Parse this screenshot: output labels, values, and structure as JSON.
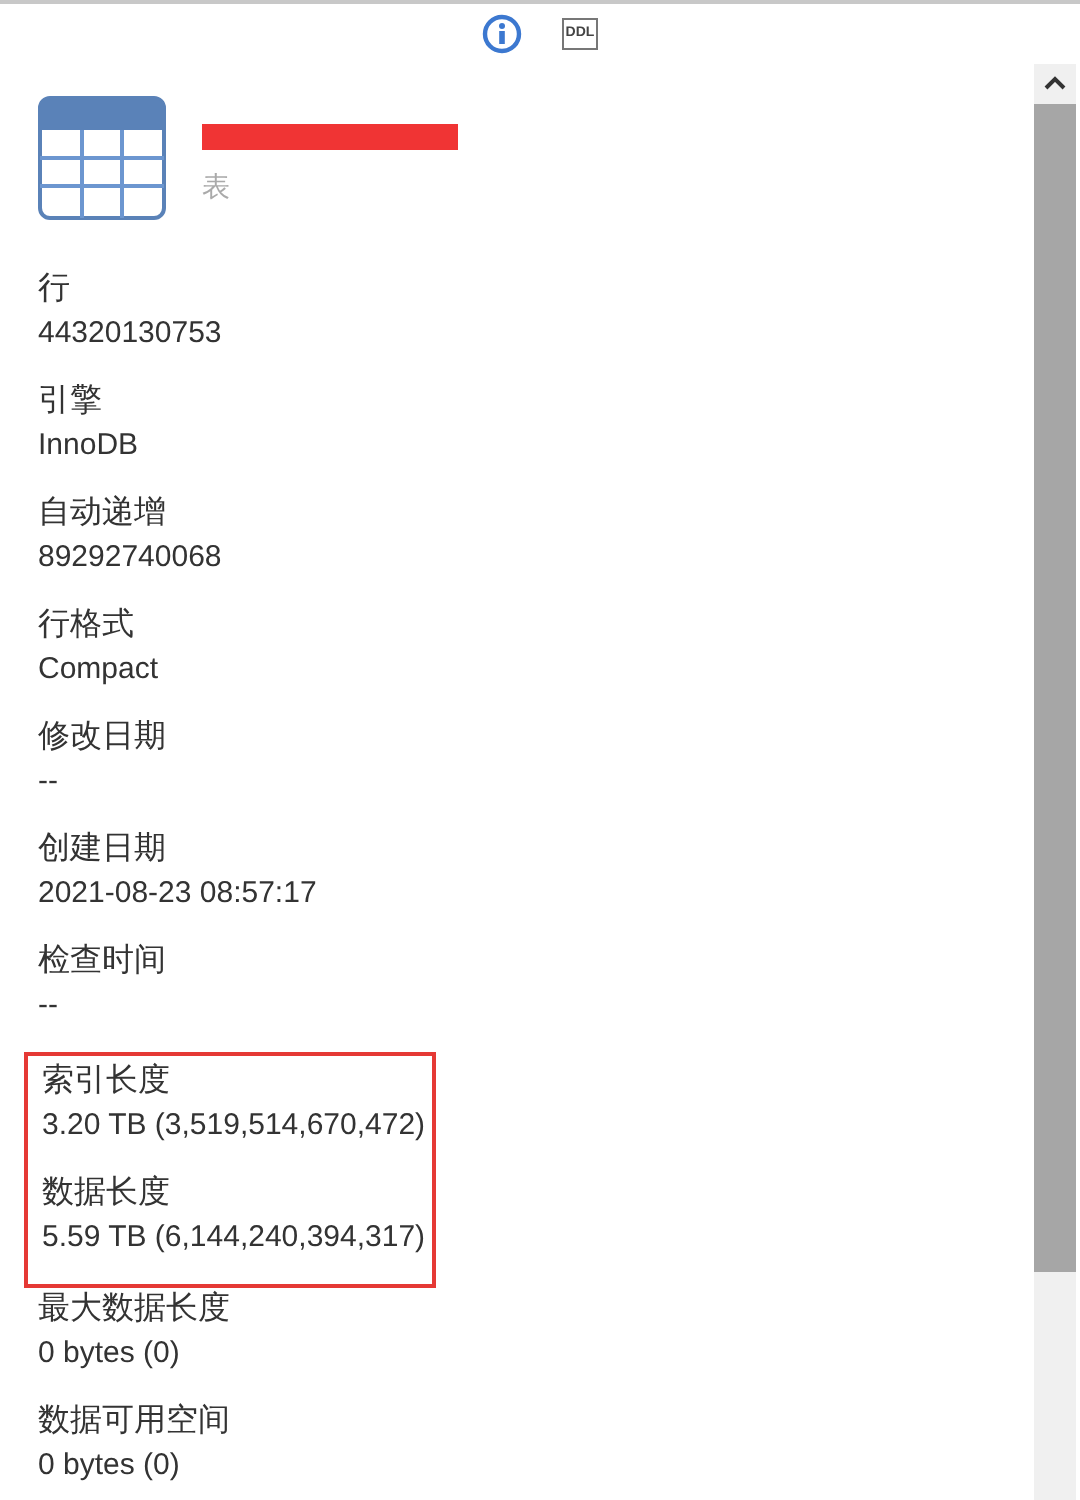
{
  "toolbar": {
    "ddl_label": "DDL"
  },
  "header": {
    "subtitle": "表"
  },
  "properties": [
    {
      "label": "行",
      "value": "44320130753",
      "highlighted": false
    },
    {
      "label": "引擎",
      "value": "InnoDB",
      "highlighted": false
    },
    {
      "label": "自动递增",
      "value": "89292740068",
      "highlighted": false
    },
    {
      "label": "行格式",
      "value": "Compact",
      "highlighted": false
    },
    {
      "label": "修改日期",
      "value": "--",
      "highlighted": false
    },
    {
      "label": "创建日期",
      "value": "2021-08-23 08:57:17",
      "highlighted": false
    },
    {
      "label": "检查时间",
      "value": "--",
      "highlighted": false
    },
    {
      "label": "索引长度",
      "value": "3.20 TB (3,519,514,670,472)",
      "highlighted": true
    },
    {
      "label": "数据长度",
      "value": "5.59 TB (6,144,240,394,317)",
      "highlighted": true
    },
    {
      "label": "最大数据长度",
      "value": "0 bytes (0)",
      "highlighted": false
    },
    {
      "label": "数据可用空间",
      "value": "0 bytes (0)",
      "highlighted": false
    }
  ]
}
